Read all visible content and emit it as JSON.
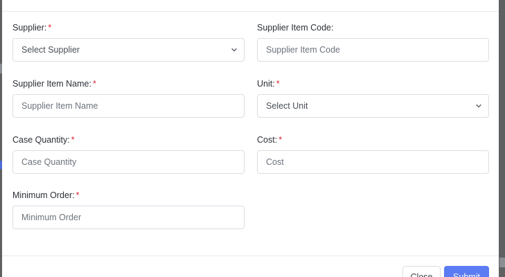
{
  "form": {
    "supplier": {
      "label": "Supplier:",
      "required_mark": "*",
      "placeholder": "Select Supplier"
    },
    "supplier_item_code": {
      "label": "Supplier Item Code:",
      "placeholder": "Supplier Item Code"
    },
    "supplier_item_name": {
      "label": "Supplier Item Name:",
      "required_mark": "*",
      "placeholder": "Supplier Item Name"
    },
    "unit": {
      "label": "Unit:",
      "required_mark": "*",
      "placeholder": "Select Unit"
    },
    "case_quantity": {
      "label": "Case Quantity:",
      "required_mark": "*",
      "placeholder": "Case Quantity"
    },
    "cost": {
      "label": "Cost:",
      "required_mark": "*",
      "placeholder": "Cost"
    },
    "minimum_order": {
      "label": "Minimum Order:",
      "required_mark": "*",
      "placeholder": "Minimum Order"
    }
  },
  "footer": {
    "close_label": "Close",
    "submit_label": "Submit"
  },
  "colors": {
    "required": "#e0242d",
    "primary": "#5b7cf2",
    "border": "#dadde3"
  },
  "icons": {
    "select_arrow": "chevron-down-icon"
  }
}
